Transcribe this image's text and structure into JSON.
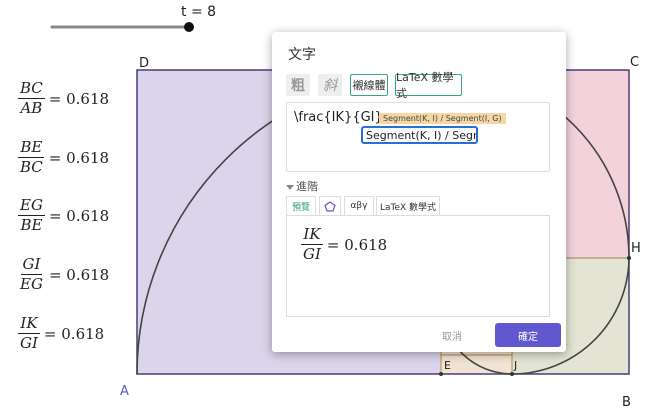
{
  "slider": {
    "label": "t = 8"
  },
  "points": {
    "A": "A",
    "B": "B",
    "C": "C",
    "D": "D",
    "E": "E",
    "H": "H",
    "J": "J"
  },
  "ratios": [
    {
      "num": "BC",
      "den": "AB",
      "eq": "= 0.618"
    },
    {
      "num": "BE",
      "den": "BC",
      "eq": "= 0.618"
    },
    {
      "num": "EG",
      "den": "BE",
      "eq": "= 0.618"
    },
    {
      "num": "GI",
      "den": "EG",
      "eq": "= 0.618"
    },
    {
      "num": "IK",
      "den": "GI",
      "eq": "= 0.618"
    }
  ],
  "dialog": {
    "title": "文字",
    "bold_label": "粗",
    "italic_label": "斜",
    "serif_label": "襯線體",
    "latex_label": "LaTeX 數學式",
    "editor_text": "\\frac{IK}{GI}=",
    "chip_text": "Segment(K, I) / Segment(I, G)",
    "chip_input_value": "Segment(K, I) / Segment(I, G)",
    "advanced_label": "進階",
    "tabs": {
      "preview": "預覽",
      "greek": "αβγ",
      "latex": "LaTeX 數學式"
    },
    "preview": {
      "num": "IK",
      "den": "GI",
      "eq": "= 0.618"
    },
    "cancel_label": "取消",
    "ok_label": "確定"
  }
}
